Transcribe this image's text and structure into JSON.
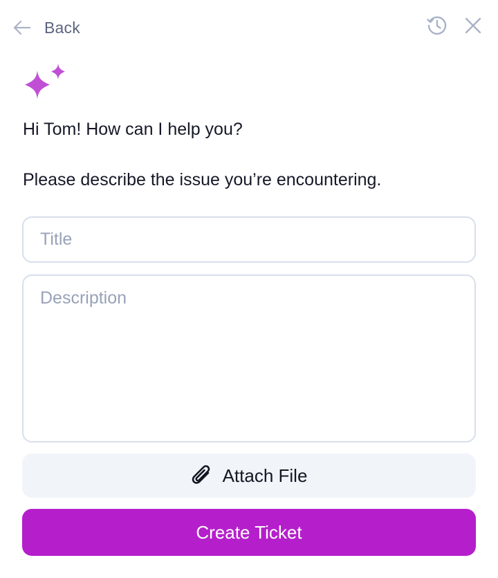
{
  "header": {
    "back_label": "Back",
    "back_icon": "arrow-left-icon",
    "history_icon": "history-icon",
    "close_icon": "close-icon"
  },
  "assistant": {
    "icon": "sparkle-icon",
    "greeting": "Hi Tom! How can I help you?",
    "prompt": "Please describe the issue you’re encountering."
  },
  "form": {
    "title_value": "",
    "title_placeholder": "Title",
    "description_value": "",
    "description_placeholder": "Description",
    "attach_label": "Attach File",
    "attach_icon": "paperclip-icon",
    "submit_label": "Create Ticket"
  },
  "colors": {
    "accent": "#b51fcb",
    "sparkle": "#c04fd6",
    "muted_text": "#5b6480",
    "icon_gray": "#a9b2c6",
    "field_border": "#d7dfeb",
    "attach_bg": "#f1f4f9"
  }
}
